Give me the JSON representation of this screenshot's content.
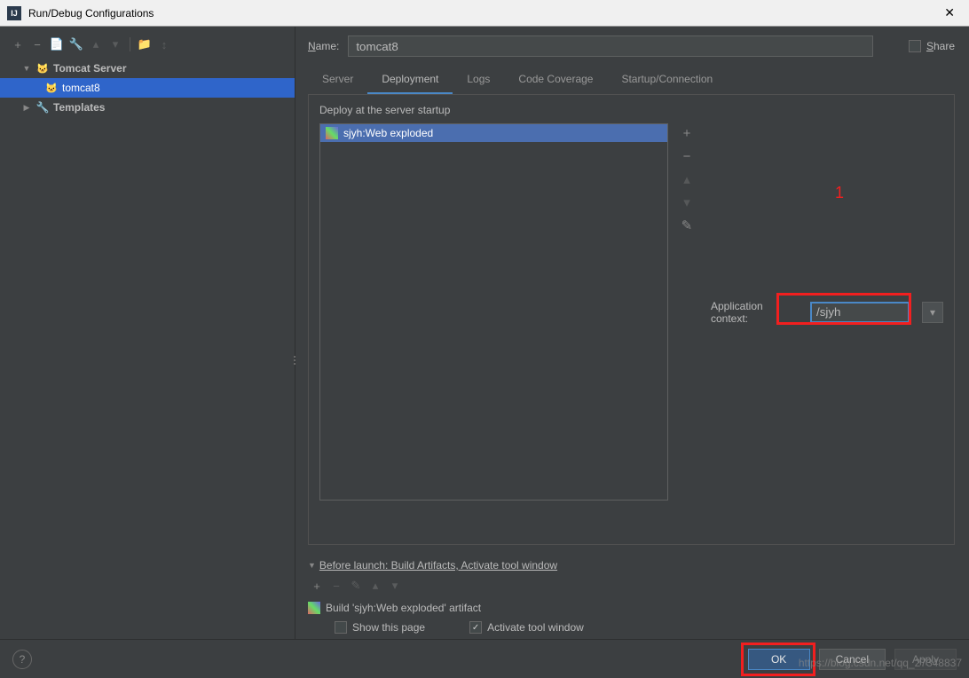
{
  "window": {
    "title": "Run/Debug Configurations"
  },
  "sidebar": {
    "items": [
      {
        "label": "Tomcat Server",
        "expandable": true
      },
      {
        "label": "tomcat8",
        "selected": true
      },
      {
        "label": "Templates",
        "expandable": true
      }
    ]
  },
  "form": {
    "name_label": "Name:",
    "name_value": "tomcat8",
    "share_label": "Share"
  },
  "tabs": {
    "items": [
      "Server",
      "Deployment",
      "Logs",
      "Code Coverage",
      "Startup/Connection"
    ],
    "active": "Deployment"
  },
  "deployment": {
    "section_label": "Deploy at the server startup",
    "artifact": "sjyh:Web exploded",
    "context_label": "Application context:",
    "context_value": "/sjyh"
  },
  "before_launch": {
    "header": "Before launch: Build Artifacts, Activate tool window",
    "task": "Build 'sjyh:Web exploded' artifact",
    "show_page": "Show this page",
    "activate_window": "Activate tool window"
  },
  "buttons": {
    "ok": "OK",
    "cancel": "Cancel",
    "apply": "Apply"
  },
  "annotations": {
    "marker1": "1"
  },
  "watermark": "https://blog.csdn.net/qq_27348837"
}
